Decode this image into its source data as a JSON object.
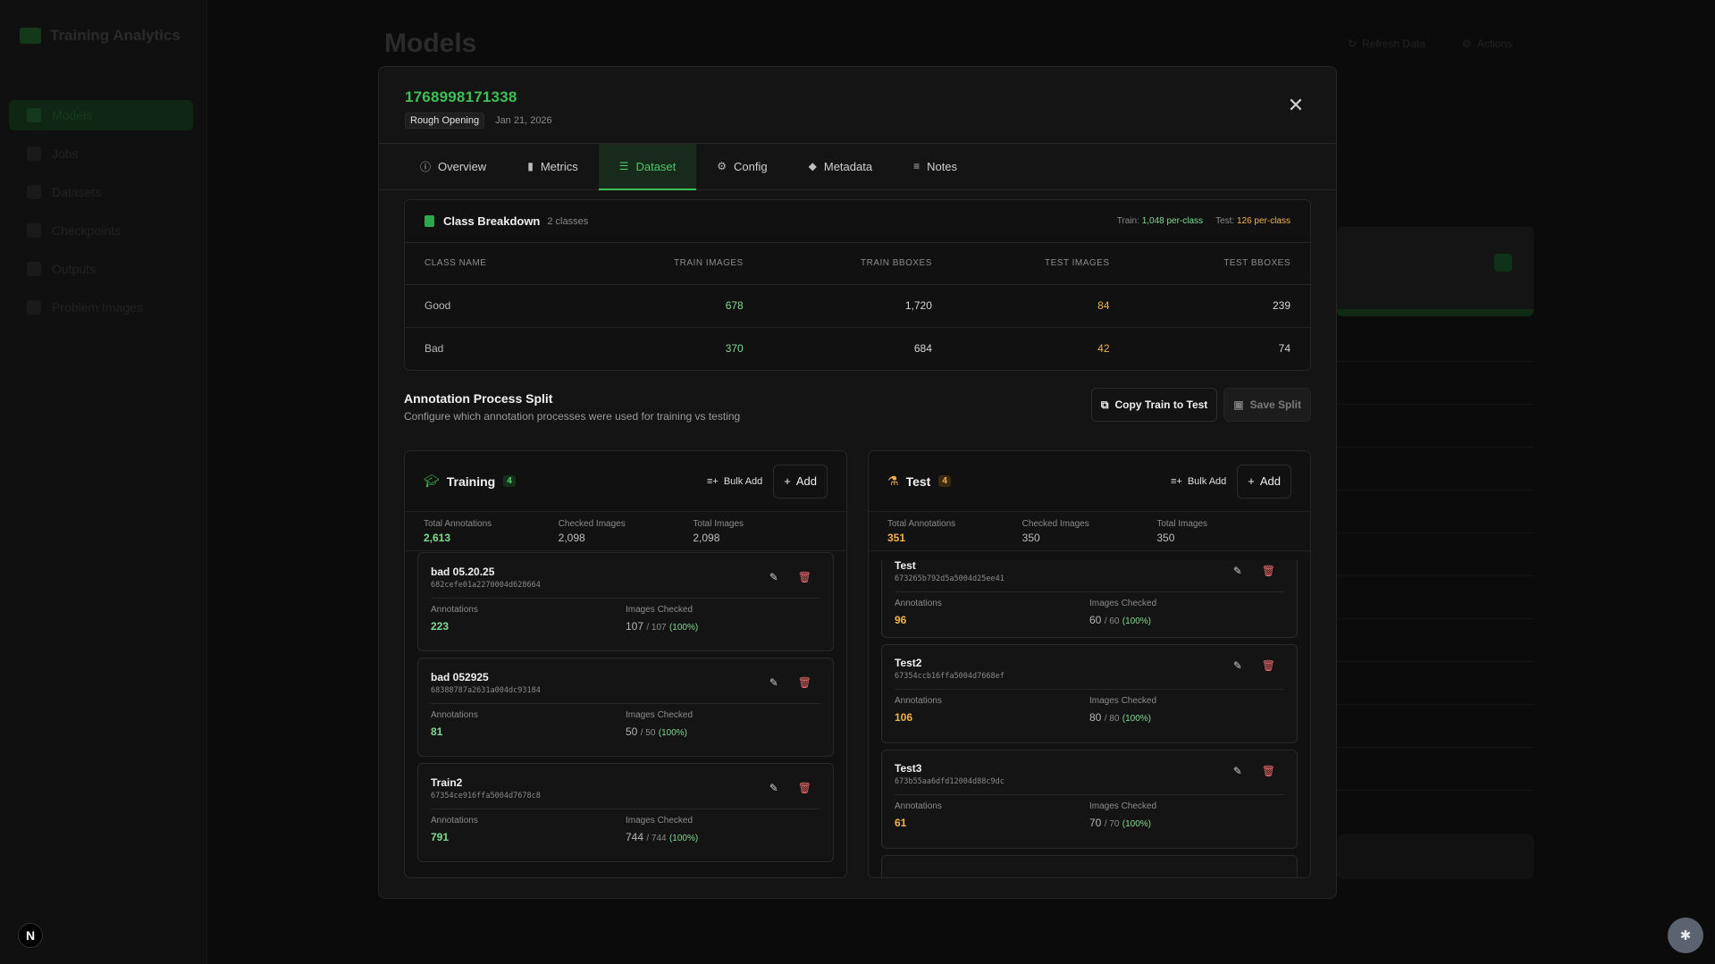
{
  "background": {
    "app_title": "Training Analytics",
    "app_subtitle": "",
    "nav": [
      {
        "label": "Models"
      },
      {
        "label": "Jobs"
      },
      {
        "label": "Datasets"
      },
      {
        "label": "Checkpoints"
      },
      {
        "label": "Outputs"
      },
      {
        "label": "Problem Images"
      }
    ],
    "page_title": "Models",
    "top_buttons": [
      "Refresh Data",
      "Actions"
    ]
  },
  "modal": {
    "model_id": "1768998171338",
    "process_badge": "Rough Opening",
    "date": "Jan 21, 2026",
    "tabs": [
      {
        "label": "Overview",
        "icon": "info-icon"
      },
      {
        "label": "Metrics",
        "icon": "bar-chart-icon"
      },
      {
        "label": "Dataset",
        "icon": "list-icon"
      },
      {
        "label": "Config",
        "icon": "gear-icon"
      },
      {
        "label": "Metadata",
        "icon": "tag-icon"
      },
      {
        "label": "Notes",
        "icon": "notes-icon"
      }
    ],
    "active_tab": "Dataset"
  },
  "class_breakdown": {
    "title": "Class Breakdown",
    "count_label": "2 classes",
    "train_label": "Train:",
    "train_value": "1,048 per-class",
    "test_label": "Test:",
    "test_value": "126 per-class",
    "columns": [
      "CLASS NAME",
      "TRAIN IMAGES",
      "TRAIN BBOXES",
      "TEST IMAGES",
      "TEST BBOXES"
    ],
    "rows": [
      {
        "name": "Good",
        "train_images": "678",
        "train_bboxes": "1,720",
        "test_images": "84",
        "test_bboxes": "239"
      },
      {
        "name": "Bad",
        "train_images": "370",
        "train_bboxes": "684",
        "test_images": "42",
        "test_bboxes": "74"
      }
    ]
  },
  "split": {
    "title": "Annotation Process Split",
    "description": "Configure which annotation processes were used for training vs testing",
    "copy_label": "Copy Train to Test",
    "save_label": "Save Split",
    "stat_labels": [
      "Total Annotations",
      "Checked Images",
      "Total Images"
    ],
    "item_labels": {
      "annotations": "Annotations",
      "images_checked": "Images Checked"
    },
    "bulk_label": "Bulk Add",
    "add_label": "Add",
    "training": {
      "title": "Training",
      "count": "4",
      "total_annotations": "2,613",
      "checked_images": "2,098",
      "total_images": "2,098",
      "items": [
        {
          "name": "bad 05.20.25",
          "id": "682cefe01a2270004d628664",
          "annotations": "223",
          "checked": "107",
          "total": "/ 107",
          "pct": "(100%)"
        },
        {
          "name": "bad 052925",
          "id": "68388787a2631a004dc93184",
          "annotations": "81",
          "checked": "50",
          "total": "/ 50",
          "pct": "(100%)"
        },
        {
          "name": "Train2",
          "id": "67354ce916ffa5004d7678c8",
          "annotations": "791",
          "checked": "744",
          "total": "/ 744",
          "pct": "(100%)"
        }
      ]
    },
    "test": {
      "title": "Test",
      "count": "4",
      "total_annotations": "351",
      "checked_images": "350",
      "total_images": "350",
      "items": [
        {
          "name": "Test",
          "id": "673265b792d5a5004d25ee41",
          "annotations": "96",
          "checked": "60",
          "total": "/ 60",
          "pct": "(100%)"
        },
        {
          "name": "Test2",
          "id": "67354ccb16ffa5004d7668ef",
          "annotations": "106",
          "checked": "80",
          "total": "/ 80",
          "pct": "(100%)"
        },
        {
          "name": "Test3",
          "id": "673b55aa6dfd12004d88c9dc",
          "annotations": "61",
          "checked": "70",
          "total": "/ 70",
          "pct": "(100%)"
        }
      ]
    }
  },
  "colors": {
    "accent_green": "#3fbf57",
    "accent_orange": "#f0b24a",
    "danger": "#ef6b6b"
  }
}
